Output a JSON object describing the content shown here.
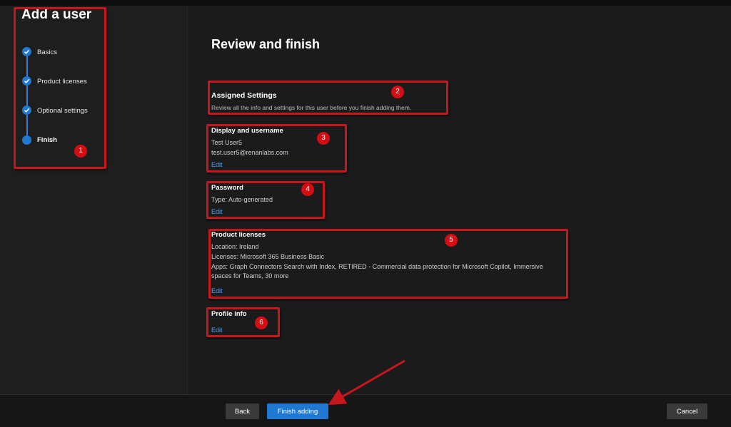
{
  "wizard": {
    "title": "Add a user",
    "steps": [
      {
        "label": "Basics",
        "status": "completed"
      },
      {
        "label": "Product licenses",
        "status": "completed"
      },
      {
        "label": "Optional settings",
        "status": "completed"
      },
      {
        "label": "Finish",
        "status": "current"
      }
    ]
  },
  "main": {
    "title": "Review and finish",
    "assigned": {
      "title": "Assigned Settings",
      "description": "Review all the info and settings for this user before you finish adding them."
    },
    "display": {
      "title": "Display and username",
      "name": "Test User5",
      "username": "test.user5@renanlabs.com",
      "edit": "Edit"
    },
    "password": {
      "title": "Password",
      "type": "Type: Auto-generated",
      "edit": "Edit"
    },
    "licenses": {
      "title": "Product licenses",
      "location": "Location: Ireland",
      "licenses": "Licenses: Microsoft 365 Business Basic",
      "apps_line1": "Apps: Graph Connectors Search with Index, RETIRED - Commercial data protection for Microsoft Copilot, Immersive",
      "apps_line2": "spaces for Teams, 30 more",
      "edit": "Edit"
    },
    "profile": {
      "title": "Profile info",
      "edit": "Edit"
    }
  },
  "annotations": [
    "1",
    "2",
    "3",
    "4",
    "5",
    "6"
  ],
  "footer": {
    "back": "Back",
    "finish": "Finish adding",
    "cancel": "Cancel"
  },
  "colors": {
    "accent": "#1f78d1",
    "link": "#4aa3ff",
    "highlight": "#c8161d"
  }
}
